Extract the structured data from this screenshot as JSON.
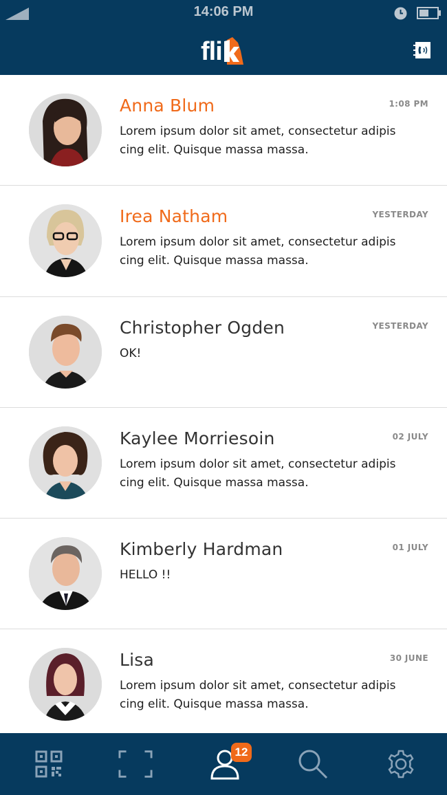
{
  "status_bar": {
    "time": "14:06 PM"
  },
  "header": {
    "logo_text": "fli",
    "logo_k": "k",
    "icons": [
      "signal-icon",
      "clock-icon",
      "battery-icon",
      "phone-contact-icon"
    ]
  },
  "colors": {
    "brand_navy": "#063a5e",
    "accent_orange": "#f06a1a",
    "text_dark": "#333333",
    "timestamp_gray": "#8a8a8a"
  },
  "messages": [
    {
      "name": "Anna Blum",
      "time": "1:08 PM",
      "text": "Lorem ipsum dolor sit amet, consectetur adipis cing elit. Quisque massa massa.",
      "unread": true
    },
    {
      "name": "Irea Natham",
      "time": "YESTERDAY",
      "text": "Lorem ipsum dolor sit amet, consectetur adipis cing elit. Quisque massa massa.",
      "unread": true
    },
    {
      "name": "Christopher Ogden",
      "time": "YESTERDAY",
      "text": "OK!",
      "unread": false
    },
    {
      "name": "Kaylee Morriesoin",
      "time": "02 JULY",
      "text": "Lorem ipsum dolor sit amet, consectetur adipis cing elit. Quisque massa massa.",
      "unread": false
    },
    {
      "name": "Kimberly Hardman",
      "time": "01 JULY",
      "text": "HELLO !!",
      "unread": false
    },
    {
      "name": "Lisa",
      "time": "30 JUNE",
      "text": "Lorem ipsum dolor sit amet, consectetur adipis cing elit. Quisque massa massa.",
      "unread": false
    }
  ],
  "tabbar": {
    "tabs": [
      {
        "icon": "qr-code-icon"
      },
      {
        "icon": "scan-frame-icon"
      },
      {
        "icon": "contacts-icon",
        "badge": "12",
        "active": true
      },
      {
        "icon": "search-icon"
      },
      {
        "icon": "settings-gear-icon"
      }
    ]
  }
}
